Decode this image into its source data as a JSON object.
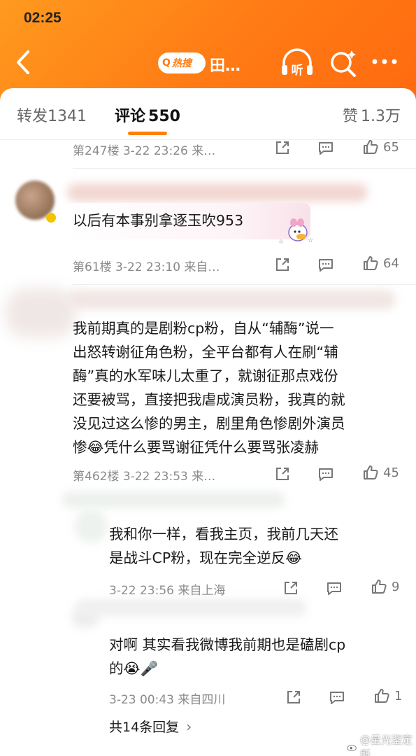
{
  "status_bar": {
    "time": "02:25"
  },
  "header": {
    "hot_tag": "热搜",
    "topic_title": "田…",
    "listen_label": "听",
    "colors": {
      "accent": "#ff8200",
      "header_bg": "#ff7a14"
    }
  },
  "tabs": [
    {
      "label": "转发",
      "count": "1341"
    },
    {
      "label": "评论",
      "count": "550"
    },
    {
      "label": "赞",
      "count": "1.3万"
    }
  ],
  "comments": [
    {
      "meta": "第247楼  3-22 23:26  来…",
      "share_icon": "share-icon",
      "comment_icon": "comment-icon",
      "likes": "65"
    },
    {
      "text": "以后有本事别拿逐玉吹953",
      "meta": "第61楼  3-22 23:10  来自…",
      "likes": "64"
    },
    {
      "lines": [
        "我前期真的是剧粉cp粉，自从“辅酶”说一",
        "出怒转谢征角色粉，全平台都有人在刷“辅",
        "酶”真的水军味儿太重了，就谢征那点戏份",
        "还要被骂，直接把我虐成演员粉，我真的就",
        "没见过这么惨的男主，剧里角色惨剧外演员",
        "惨😂凭什么要骂谢征凭什么要骂张凌赫"
      ],
      "meta": "第462楼  3-22 23:53  来…",
      "likes": "45",
      "replies": [
        {
          "lines": [
            "我和你一样，看我主页，我前几天还",
            "是战斗CP粉，现在完全逆反😂"
          ],
          "meta": "3-22 23:56  来自上海",
          "likes": "9"
        },
        {
          "lines": [
            "对啊 其实看我微博我前期也是磕剧cp",
            "的😭🎤"
          ],
          "meta": "3-23 00:43  来自四川",
          "likes": "1"
        }
      ],
      "more_replies": "共14条回复"
    }
  ],
  "watermark": "@星光鉴定所"
}
